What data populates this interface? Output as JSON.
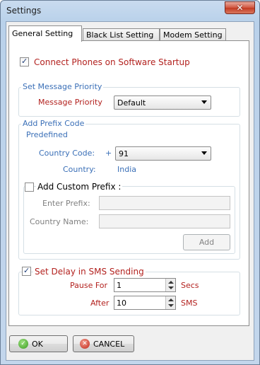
{
  "window": {
    "title": "Settings",
    "close_icon": "close-icon"
  },
  "tabs": [
    {
      "label": "General Setting",
      "active": true
    },
    {
      "label": "Black List Setting",
      "active": false
    },
    {
      "label": "Modem Setting",
      "active": false
    }
  ],
  "general": {
    "connect_on_startup": {
      "label": "Connect Phones on Software Startup",
      "checked": true
    },
    "message_priority_group": {
      "legend": "Set Message Priority",
      "label": "Message Priority",
      "value": "Default"
    },
    "prefix_group": {
      "legend": "Add Prefix Code",
      "predefined": {
        "legend": "Predefined",
        "country_code_label": "Country Code:",
        "plus": "+",
        "country_code_value": "91",
        "country_label": "Country:",
        "country_value": "India"
      },
      "custom": {
        "label": "Add Custom Prefix :",
        "checked": false,
        "enter_prefix_label": "Enter Prefix:",
        "enter_prefix_value": "",
        "country_name_label": "Country Name:",
        "country_name_value": "",
        "add_button": "Add"
      }
    },
    "delay_group": {
      "label": "Set Delay in SMS Sending",
      "checked": true,
      "pause_label": "Pause For",
      "pause_value": "1",
      "pause_unit": "Secs",
      "after_label": "After",
      "after_value": "10",
      "after_unit": "SMS"
    }
  },
  "footer": {
    "ok": "OK",
    "cancel": "CANCEL"
  },
  "colors": {
    "label_red": "#b3221f",
    "label_blue": "#3a6fb7"
  }
}
